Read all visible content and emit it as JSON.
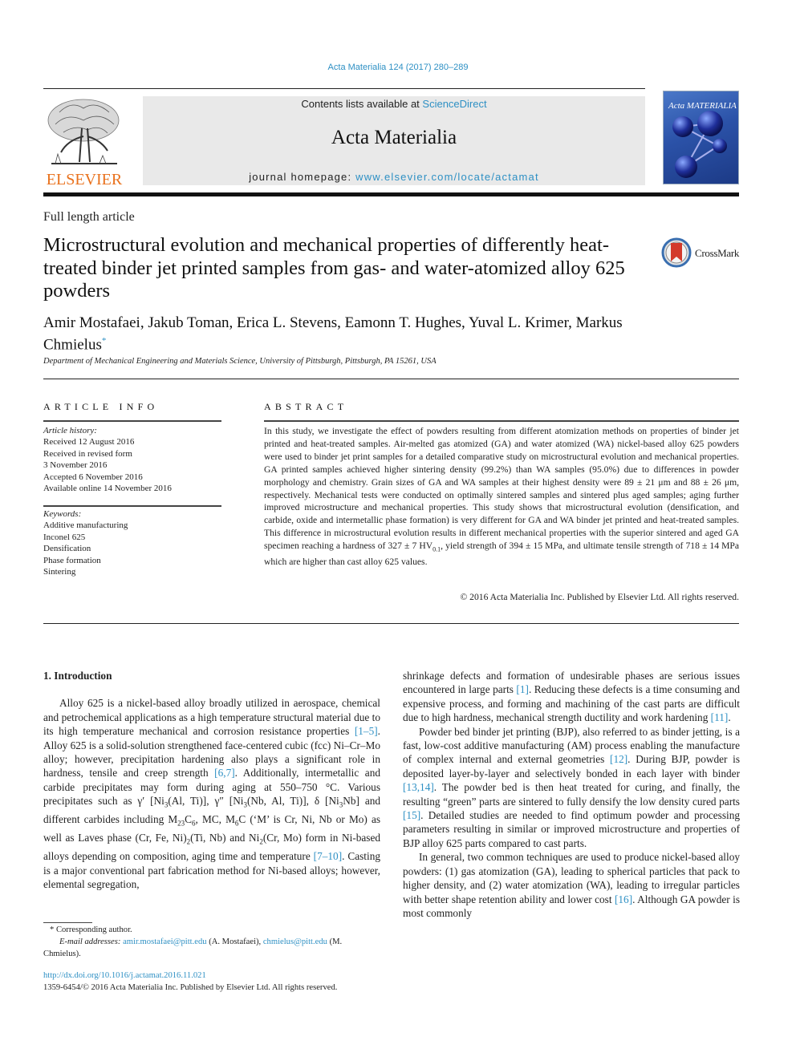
{
  "header": {
    "citation": "Acta Materialia 124 (2017) 280–289",
    "publisher_logo_text": "ELSEVIER",
    "contents_prefix": "Contents lists available at ",
    "contents_link": "ScienceDirect",
    "journal_name": "Acta Materialia",
    "homepage_prefix": "journal homepage: ",
    "homepage_link": "www.elsevier.com/locate/actamat",
    "cover_title": "Acta MATERIALIA",
    "crossmark_label": "CrossMark"
  },
  "article": {
    "type": "Full length article",
    "title": "Microstructural evolution and mechanical properties of differently heat-treated binder jet printed samples from gas- and water-atomized alloy 625 powders",
    "authors": "Amir Mostafaei, Jakub Toman, Erica L. Stevens, Eamonn T. Hughes, Yuval L. Krimer, Markus Chmielus",
    "corresponding_mark": "*",
    "affiliation": "Department of Mechanical Engineering and Materials Science, University of Pittsburgh, Pittsburgh, PA 15261, USA"
  },
  "article_info": {
    "heading": "ARTICLE INFO",
    "history_label": "Article history:",
    "history": [
      "Received 12 August 2016",
      "Received in revised form",
      "3 November 2016",
      "Accepted 6 November 2016",
      "Available online 14 November 2016"
    ],
    "keywords_label": "Keywords:",
    "keywords": [
      "Additive manufacturing",
      "Inconel 625",
      "Densification",
      "Phase formation",
      "Sintering"
    ]
  },
  "abstract": {
    "heading": "ABSTRACT",
    "text_1": "In this study, we investigate the effect of powders resulting from different atomization methods on properties of binder jet printed and heat-treated samples. Air-melted gas atomized (GA) and water atomized (WA) nickel-based alloy 625 powders were used to binder jet print samples for a detailed comparative study on microstructural evolution and mechanical properties. GA printed samples achieved higher sintering density (99.2%) than WA samples (95.0%) due to differences in powder morphology and chemistry. Grain sizes of GA and WA samples at their highest density were 89 ± 21 μm and 88 ± 26 μm, respectively. Mechanical tests were conducted on optimally sintered samples and sintered plus aged samples; aging further improved microstructure and mechanical properties. This study shows that microstructural evolution (densification, and carbide, oxide and intermetallic phase formation) is very different for GA and WA binder jet printed and heat-treated samples. This difference in microstructural evolution results in different mechanical properties with the superior sintered and aged GA specimen reaching a hardness of 327 ± 7 HV",
    "hv_sub": "0.1",
    "text_2": ", yield strength of 394 ± 15 MPa, and ultimate tensile strength of 718 ± 14 MPa which are higher than cast alloy 625 values.",
    "copyright": "© 2016 Acta Materialia Inc. Published by Elsevier Ltd. All rights reserved."
  },
  "body": {
    "section_heading": "1.  Introduction",
    "left": {
      "p1_a": "Alloy 625 is a nickel-based alloy broadly utilized in aerospace, chemical and petrochemical applications as a high temperature structural material due to its high temperature mechanical and corrosion resistance properties ",
      "ref_1_5": "[1–5]",
      "p1_b": ". Alloy 625 is a solid-solution strengthened face-centered cubic (fcc) Ni–Cr–Mo alloy; however, precipitation hardening also plays a significant role in hardness, tensile and creep strength ",
      "ref_6_7": "[6,7]",
      "p1_c": ". Additionally, intermetallic and carbide precipitates may form during aging at 550–750 °C. Various precipitates such as γ′ [Ni",
      "p1_d": "(Al, Ti)], γ″ [Ni",
      "p1_e": "(Nb, Al, Ti)], δ [Ni",
      "p1_f": "Nb] and different carbides including M",
      "p1_g": "C",
      "p1_h": ", MC, M",
      "p1_i": "C (‘M’ is Cr, Ni, Nb or Mo) as well as Laves phase (Cr, Fe, Ni)",
      "p1_j": "(Ti, Nb) and Ni",
      "p1_k": "(Cr, Mo) form in Ni-based alloys depending on composition, aging time and temperature ",
      "ref_7_10": "[7–10]",
      "p1_l": ". Casting is a major conventional part fabrication method for Ni-based alloys; however, elemental segregation,",
      "sub_3": "3",
      "sub_23": "23",
      "sub_6": "6",
      "sub_2": "2"
    },
    "right": {
      "p1_a": "shrinkage defects and formation of undesirable phases are serious issues encountered in large parts ",
      "ref_1": "[1]",
      "p1_b": ". Reducing these defects is a time consuming and expensive process, and forming and machining of the cast parts are difficult due to high hardness, mechanical strength ductility and work hardening ",
      "ref_11": "[11]",
      "p1_c": ".",
      "p2_a": "Powder bed binder jet printing (BJP), also referred to as binder jetting, is a fast, low-cost additive manufacturing (AM) process enabling the manufacture of complex internal and external geometries ",
      "ref_12": "[12]",
      "p2_b": ". During BJP, powder is deposited layer-by-layer and selectively bonded in each layer with binder ",
      "ref_13_14": "[13,14]",
      "p2_c": ". The powder bed is then heat treated for curing, and finally, the resulting “green” parts are sintered to fully densify the low density cured parts ",
      "ref_15": "[15]",
      "p2_d": ". Detailed studies are needed to find optimum powder and processing parameters resulting in similar or improved microstructure and properties of BJP alloy 625 parts compared to cast parts.",
      "p3_a": "In general, two common techniques are used to produce nickel-based alloy powders: (1) gas atomization (GA), leading to spherical particles that pack to higher density, and (2) water atomization (WA), leading to irregular particles with better shape retention ability and lower cost ",
      "ref_16": "[16]",
      "p3_b": ". Although GA powder is most commonly"
    }
  },
  "footnote": {
    "corresponding": "* Corresponding author.",
    "email_label": "E-mail addresses:",
    "email_1": "amir.mostafaei@pitt.edu",
    "email_1_owner": " (A. Mostafaei), ",
    "email_2": "chmielus@pitt.edu",
    "email_2_owner": " (M. Chmielus).",
    "doi": "http://dx.doi.org/10.1016/j.actamat.2016.11.021",
    "issn_line": "1359-6454/© 2016 Acta Materialia Inc. Published by Elsevier Ltd. All rights reserved."
  }
}
